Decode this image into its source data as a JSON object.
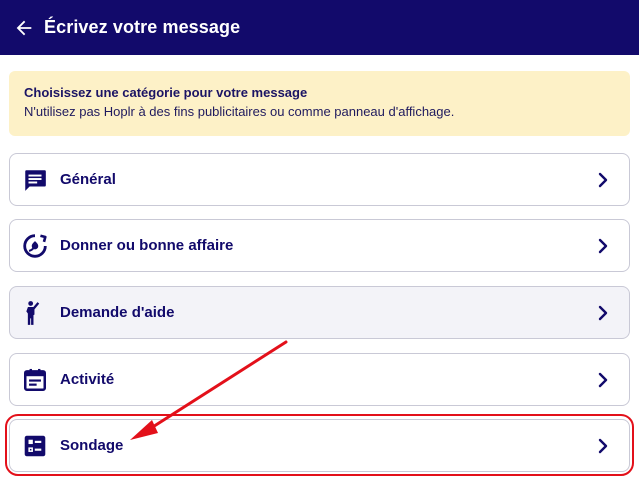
{
  "header": {
    "title": "Écrivez votre message"
  },
  "notice": {
    "title": "Choisissez une catégorie pour votre message",
    "text": "N'utilisez pas Hoplr à des fins publicitaires ou comme panneau d'affichage."
  },
  "categories": [
    {
      "label": "Général",
      "icon": "message-icon"
    },
    {
      "label": "Donner ou bonne affaire",
      "icon": "recycle-icon"
    },
    {
      "label": "Demande d'aide",
      "icon": "person-raising-hand-icon"
    },
    {
      "label": "Activité",
      "icon": "calendar-icon"
    },
    {
      "label": "Sondage",
      "icon": "poll-checklist-icon"
    }
  ],
  "colors": {
    "appbar": "#120a6b",
    "notice_bg": "#fdf1c7",
    "text_primary": "#120a6b",
    "annotation_red": "#e3101a"
  }
}
